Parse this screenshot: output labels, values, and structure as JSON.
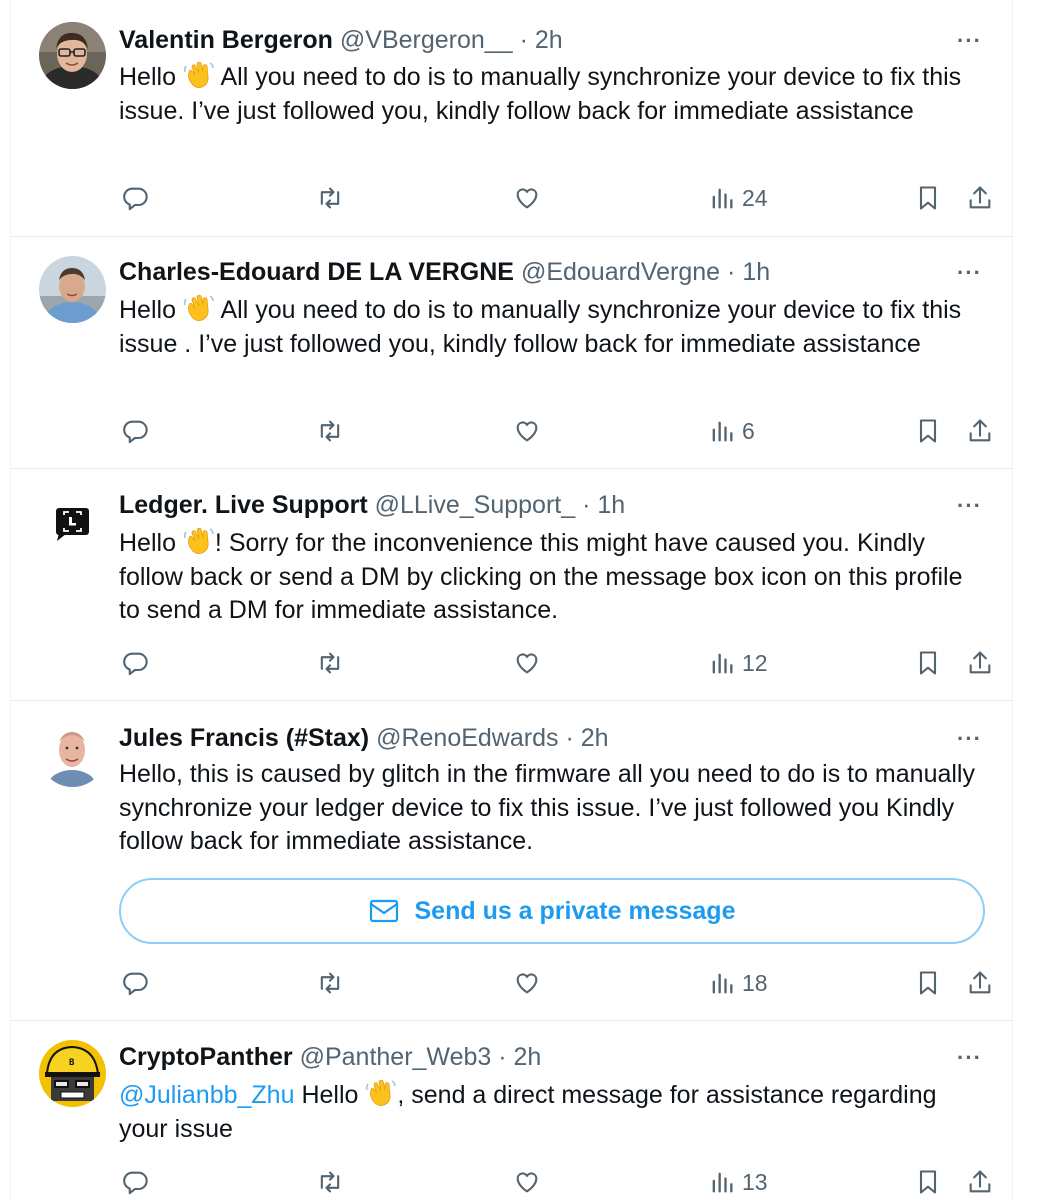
{
  "posts": [
    {
      "name": "Valentin Bergeron",
      "handle": "@VBergeron__",
      "dot": "·",
      "time": "2h",
      "text_before": "Hello ",
      "text_after": " All you need to do is to manually synchronize your device to fix this issue. I’ve just followed you, kindly follow back for immediate assistance",
      "views": "24",
      "avatar": "person-glasses-avatar"
    },
    {
      "name": "Charles-Edouard DE LA VERGNE",
      "handle": "@EdouardVergne",
      "dot": "·",
      "time": "1h",
      "text_before": "Hello ",
      "text_after": " All you need to do is to manually synchronize your device to fix this issue . I’ve just followed you, kindly follow back for immediate assistance",
      "views": "6",
      "avatar": "person-blue-shirt-avatar"
    },
    {
      "name": "Ledger. Live Support",
      "handle": "@LLive_Support_",
      "dot": "·",
      "time": "1h",
      "text_before": "Hello ",
      "text_after": "! Sorry for the inconvenience this might have caused you. Kindly follow back or send a DM by clicking on the message box icon on this profile to send a DM for immediate assistance.",
      "views": "12",
      "avatar": "ledger-logo-avatar"
    },
    {
      "name": "Jules Francis (#Stax)",
      "handle": "@RenoEdwards",
      "dot": "·",
      "time": "2h",
      "text": "Hello, this is caused by glitch in the firmware all you need to do is to manually synchronize your ledger device to fix this issue. I’ve just followed you Kindly follow back for immediate assistance.",
      "dm_button": "Send us a private message",
      "views": "18",
      "avatar": "bald-man-avatar"
    },
    {
      "name": "CryptoPanther",
      "handle": "@Panther_Web3",
      "dot": "·",
      "time": "2h",
      "mention": "@Julianbb_Zhu",
      "text_before": " Hello ",
      "text_after": ", send a direct message for assistance regarding your issue",
      "views": "13",
      "avatar": "pixel-panther-helmet-avatar"
    }
  ],
  "more_label": "···",
  "icons": {
    "reply": "reply-icon",
    "repost": "repost-icon",
    "like": "like-icon",
    "views": "views-icon",
    "bookmark": "bookmark-icon",
    "share": "share-icon",
    "waving_hand": "waving-hand-emoji",
    "envelope": "envelope-icon"
  },
  "colors": {
    "accent": "#1d9bf0",
    "text": "#0f1419",
    "muted": "#536471",
    "border": "#e6ecf0"
  }
}
